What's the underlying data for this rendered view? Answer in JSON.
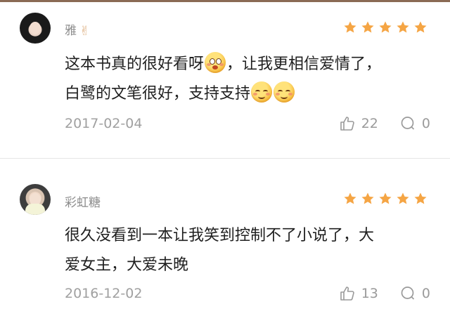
{
  "colors": {
    "star": "#f5a544",
    "meta_text": "#a0a0a0",
    "username": "#8c8c8c"
  },
  "reviews": [
    {
      "username": "雅",
      "username_icon": "victory-hand-icon",
      "rating": 5,
      "text_line1": "这本书真的很好看呀",
      "text_line1b": "，让我更相信爱情了，",
      "text_line2": "白鹭的文笔很好，支持支持",
      "emojis": [
        "surprised-face-icon",
        "blushing-smile-icon",
        "blushing-smile-icon"
      ],
      "date": "2017-02-04",
      "likes": "22",
      "comments": "0"
    },
    {
      "username": "彩虹糖",
      "rating": 5,
      "text_line1": "很久没看到一本让我笑到控制不了小说了，大",
      "text_line2": "爱女主，大爱未晚",
      "date": "2016-12-02",
      "likes": "13",
      "comments": "0"
    }
  ]
}
